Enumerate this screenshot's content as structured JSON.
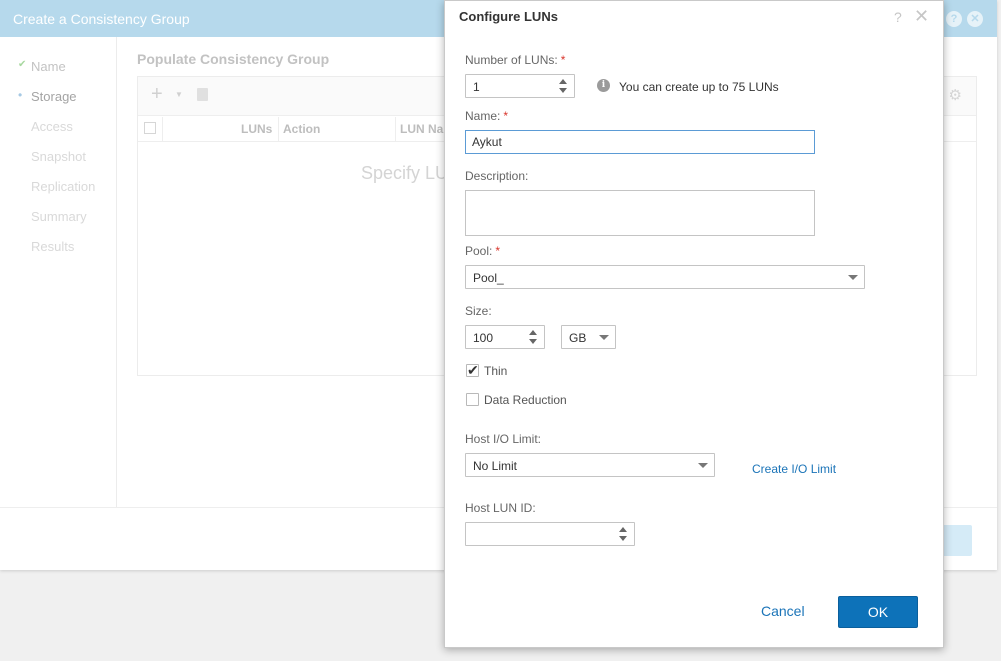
{
  "wizard": {
    "title": "Create a Consistency Group",
    "steps": [
      {
        "label": "Name",
        "state": "done"
      },
      {
        "label": "Storage",
        "state": "active"
      },
      {
        "label": "Access",
        "state": "pending"
      },
      {
        "label": "Snapshot",
        "state": "pending"
      },
      {
        "label": "Replication",
        "state": "pending"
      },
      {
        "label": "Summary",
        "state": "pending"
      },
      {
        "label": "Results",
        "state": "pending"
      }
    ],
    "section_title": "Populate Consistency Group",
    "grid": {
      "columns": [
        "LUNs",
        "Action",
        "LUN Na"
      ],
      "empty_text": "Specify LU"
    }
  },
  "dialog": {
    "title": "Configure LUNs",
    "number_of_luns": {
      "label": "Number of LUNs:",
      "required": "*",
      "value": "1"
    },
    "info_text": "You can create up to 75 LUNs",
    "name": {
      "label": "Name:",
      "required": "*",
      "value": "Aykut"
    },
    "description": {
      "label": "Description:",
      "value": ""
    },
    "pool": {
      "label": "Pool:",
      "required": "*",
      "value": "Pool_"
    },
    "size": {
      "label": "Size:",
      "value": "100",
      "unit": "GB"
    },
    "thin": {
      "label": "Thin",
      "checked": true
    },
    "data_reduction": {
      "label": "Data Reduction",
      "checked": false
    },
    "host_io_limit": {
      "label": "Host I/O Limit:",
      "value": "No Limit",
      "link": "Create I/O Limit"
    },
    "host_lun_id": {
      "label": "Host LUN ID:",
      "value": ""
    },
    "cancel_label": "Cancel",
    "ok_label": "OK"
  },
  "colors": {
    "accent": "#0d72b9",
    "link": "#1b74b8",
    "header_bg": "#b6d9ec",
    "required": "#d9342b"
  }
}
